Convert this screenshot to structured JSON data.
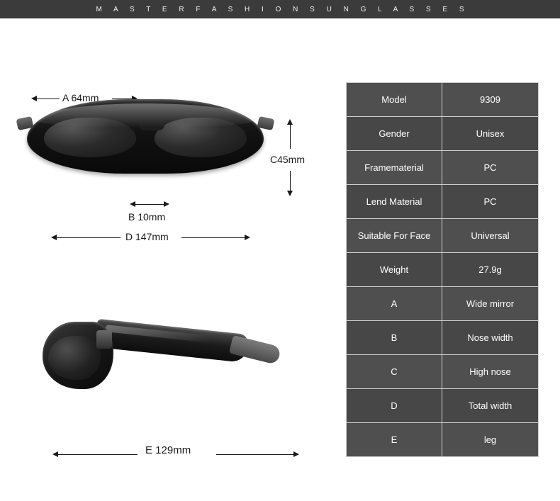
{
  "banner": {
    "text": "M A S T E R F A S H I O N S U N G L A S S E S"
  },
  "annotations": {
    "a": "A 64mm",
    "b": "B 10mm",
    "c": "C45mm",
    "d": "D 147mm",
    "e": "E 129mm"
  },
  "spec_table": {
    "rows": [
      {
        "key": "Model",
        "value": "9309"
      },
      {
        "key": "Gender",
        "value": "Unisex"
      },
      {
        "key": "Framematerial",
        "value": "PC"
      },
      {
        "key": "Lend Material",
        "value": "PC"
      },
      {
        "key": "Suitable For Face",
        "value": "Universal"
      },
      {
        "key": "Weight",
        "value": "27.9g"
      },
      {
        "key": "A",
        "value": "Wide mirror"
      },
      {
        "key": "B",
        "value": "Nose width"
      },
      {
        "key": "C",
        "value": "High nose"
      },
      {
        "key": "D",
        "value": "Total width"
      },
      {
        "key": "E",
        "value": "leg"
      }
    ]
  },
  "colors": {
    "banner_bg": "#3b3b3b",
    "table_bg": "#4d4d4d",
    "table_border": "#d0d0d0",
    "text_light": "#ffffff",
    "text_dark": "#1a1a1a"
  }
}
